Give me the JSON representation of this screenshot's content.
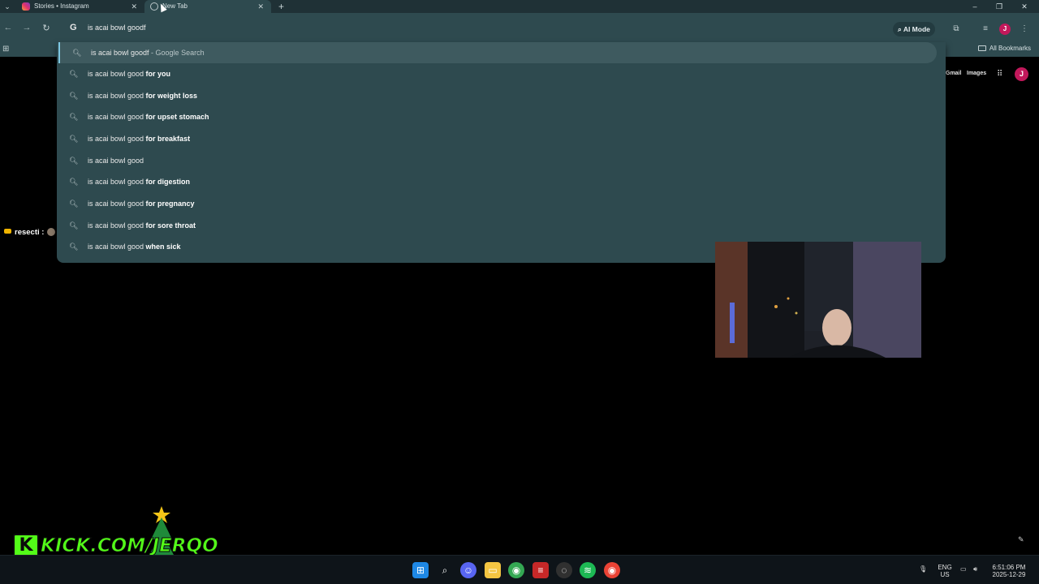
{
  "tabs": [
    {
      "title": "Stories • Instagram",
      "icon": "instagram-icon",
      "active": false
    },
    {
      "title": "New Tab",
      "icon": "chrome-icon",
      "active": true
    }
  ],
  "window": {
    "minimize": "–",
    "restore": "❐",
    "close": "✕"
  },
  "toolbar": {
    "omnibox_value": "is acai bowl goodf",
    "ai_mode_label": "AI Mode",
    "profile_initial": "J"
  },
  "bookmarks": {
    "all_bookmarks_label": "All Bookmarks"
  },
  "google_header": {
    "gmail": "Gmail",
    "images": "Images",
    "avatar_initial": "J"
  },
  "chat": {
    "username": "resecti :"
  },
  "suggestions": [
    {
      "prefix": "is acai bowl goodf",
      "bold": "",
      "suffix": " - Google Search"
    },
    {
      "prefix": "is acai bowl good ",
      "bold": "for you",
      "suffix": ""
    },
    {
      "prefix": "is acai bowl good ",
      "bold": "for weight loss",
      "suffix": ""
    },
    {
      "prefix": "is acai bowl good ",
      "bold": "for upset stomach",
      "suffix": ""
    },
    {
      "prefix": "is acai bowl good ",
      "bold": "for breakfast",
      "suffix": ""
    },
    {
      "prefix": "is acai bowl good",
      "bold": "",
      "suffix": ""
    },
    {
      "prefix": "is acai bowl good ",
      "bold": "for digestion",
      "suffix": ""
    },
    {
      "prefix": "is acai bowl good ",
      "bold": "for pregnancy",
      "suffix": ""
    },
    {
      "prefix": "is acai bowl good ",
      "bold": "for sore throat",
      "suffix": ""
    },
    {
      "prefix": "is acai bowl good ",
      "bold": "when sick",
      "suffix": ""
    }
  ],
  "overlay": {
    "kick_text": "KICK.COM/JERQO"
  },
  "taskbar": {
    "lang_line1": "ENG",
    "lang_line2": "US",
    "time": "6:51:06 PM",
    "date": "2025-12-29"
  },
  "colors": {
    "accent_profile": "#c2185b",
    "omnibox_bg": "#2e4a4f",
    "kick_green": "#53fc18"
  }
}
